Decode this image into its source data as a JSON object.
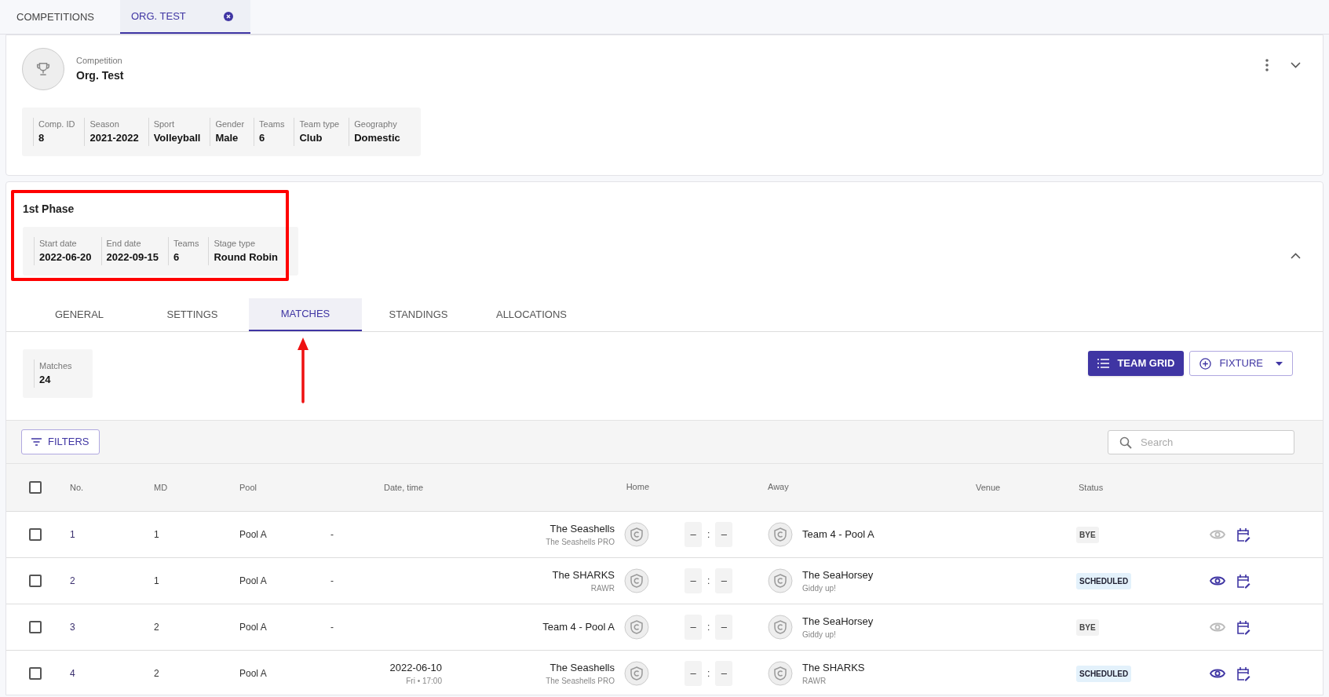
{
  "top_tabs": [
    {
      "label": "COMPETITIONS",
      "selected": false,
      "closable": false
    },
    {
      "label": "ORG. TEST",
      "selected": true,
      "closable": true
    }
  ],
  "competition": {
    "caption": "Competition",
    "name": "Org. Test",
    "info": [
      {
        "label": "Comp. ID",
        "value": "8"
      },
      {
        "label": "Season",
        "value": "2021-2022"
      },
      {
        "label": "Sport",
        "value": "Volleyball"
      },
      {
        "label": "Gender",
        "value": "Male"
      },
      {
        "label": "Teams",
        "value": "6"
      },
      {
        "label": "Team type",
        "value": "Club"
      },
      {
        "label": "Geography",
        "value": "Domestic"
      }
    ]
  },
  "phase": {
    "title": "1st Phase",
    "expanded": true,
    "info": [
      {
        "label": "Start date",
        "value": "2022-06-20"
      },
      {
        "label": "End date",
        "value": "2022-09-15"
      },
      {
        "label": "Teams",
        "value": "6"
      },
      {
        "label": "Stage type",
        "value": "Round Robin"
      }
    ]
  },
  "phase_tabs": [
    {
      "label": "GENERAL",
      "selected": false
    },
    {
      "label": "SETTINGS",
      "selected": false
    },
    {
      "label": "MATCHES",
      "selected": true
    },
    {
      "label": "STANDINGS",
      "selected": false
    },
    {
      "label": "ALLOCATIONS",
      "selected": false
    }
  ],
  "summary": {
    "label": "Matches",
    "value": "24"
  },
  "buttons": {
    "team_grid": "TEAM GRID",
    "fixture": "FIXTURE",
    "filters": "FILTERS"
  },
  "search": {
    "placeholder": "Search"
  },
  "table": {
    "select_all_checked": false,
    "columns": [
      "No.",
      "MD",
      "Pool",
      "Date, time",
      "Home",
      "Away",
      "Venue",
      "Status"
    ],
    "rows": [
      {
        "checked": false,
        "no": "1",
        "md": "1",
        "pool": "Pool A",
        "date": "-",
        "home": "The Seashells",
        "home_sub": "The Seashells PRO",
        "score_home": "–",
        "separator": ":",
        "score_away": "–",
        "away": "Team 4 - Pool A",
        "status": "BYE",
        "kind": "bye",
        "view_enabled": false
      },
      {
        "checked": false,
        "no": "2",
        "md": "1",
        "pool": "Pool A",
        "date": "-",
        "home": "The SHARKS",
        "home_sub": "RAWR",
        "score_home": "–",
        "separator": ":",
        "score_away": "–",
        "away": "The SeaHorsey",
        "away_sub": "Giddy up!",
        "status": "SCHEDULED",
        "kind": "scheduled",
        "view_enabled": true
      },
      {
        "checked": false,
        "no": "3",
        "md": "2",
        "pool": "Pool A",
        "date": "-",
        "home": "Team 4 - Pool A",
        "score_home": "–",
        "separator": ":",
        "score_away": "–",
        "away": "The SeaHorsey",
        "away_sub": "Giddy up!",
        "status": "BYE",
        "kind": "bye",
        "view_enabled": false
      },
      {
        "checked": false,
        "no": "4",
        "md": "2",
        "pool": "Pool A",
        "date": "2022-06-10",
        "time": "Fri • 17:00",
        "home": "The Seashells",
        "home_sub": "The Seashells PRO",
        "score_home": "–",
        "separator": ":",
        "score_away": "–",
        "away": "The SHARKS",
        "away_sub": "RAWR",
        "status": "SCHEDULED",
        "kind": "scheduled",
        "view_enabled": true
      }
    ]
  }
}
